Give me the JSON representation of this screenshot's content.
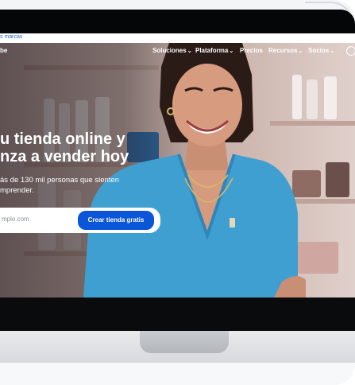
{
  "topbar": {
    "text": "s marcas"
  },
  "header": {
    "logo": "be",
    "nav": [
      {
        "label": "Soluciones",
        "has_menu": true
      },
      {
        "label": "Plataforma",
        "has_menu": true
      },
      {
        "label": "Precios",
        "has_menu": false
      },
      {
        "label": "Recursos",
        "has_menu": true
      },
      {
        "label": "Socios",
        "has_menu": true
      }
    ],
    "chevron": "⌄"
  },
  "hero": {
    "title_line1": "u tienda online y",
    "title_line2": "nza a vender hoy",
    "subtitle_line1": "ás de 130 mil personas que sienten",
    "subtitle_line2": "mprender."
  },
  "signup": {
    "email_placeholder": "mplo.com",
    "cta_label": "Crear tienda gratis"
  },
  "icons": {
    "language": "globe-icon"
  },
  "colors": {
    "cta": "#0a55d8",
    "sweater": "#3f9fd0"
  }
}
